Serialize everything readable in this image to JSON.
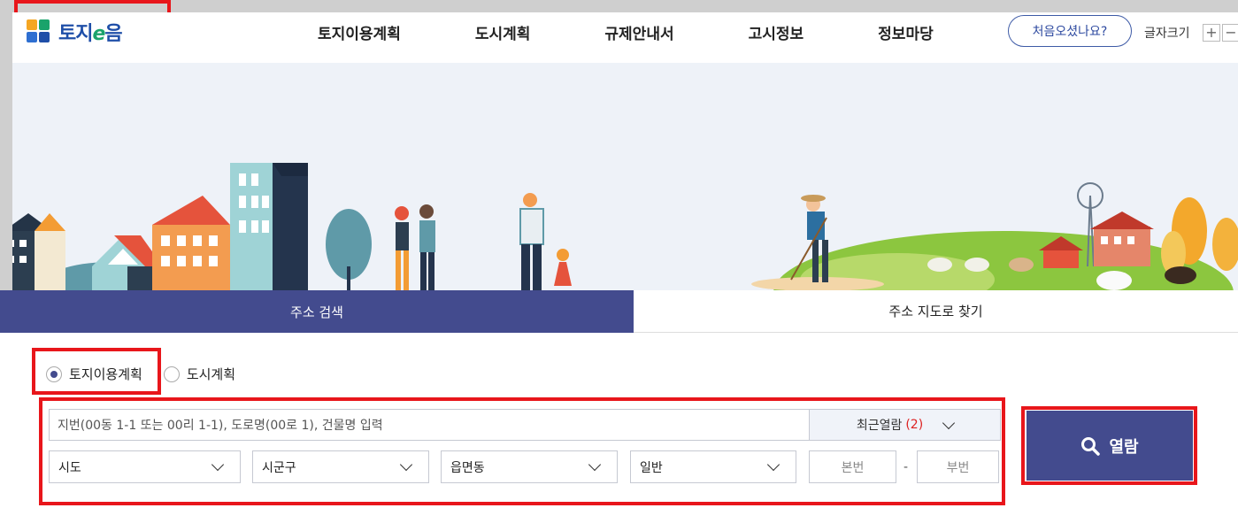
{
  "header": {
    "logo_text_a": "토지",
    "logo_text_e": "e",
    "logo_text_b": "음",
    "nav": [
      "토지이용계획",
      "도시계획",
      "규제안내서",
      "고시정보",
      "정보마당"
    ],
    "first_visit": "처음오셨나요?",
    "font_size_label": "글자크기",
    "font_plus": "+",
    "font_minus": "−"
  },
  "tabs": {
    "address_search": "주소 검색",
    "map_search": "주소 지도로 찾기"
  },
  "search": {
    "radio_land": "토지이용계획",
    "radio_city": "도시계획",
    "placeholder": "지번(00동 1-1 또는 00리 1-1), 도로명(00로 1), 건물명 입력",
    "recent_label": "최근열람",
    "recent_count": "(2)",
    "sido": "시도",
    "sigungu": "시군구",
    "eupmyeondong": "읍면동",
    "lot_type": "일반",
    "main_no": "본번",
    "dash": "-",
    "sub_no": "부번",
    "view_button": "열람"
  },
  "colors": {
    "accent": "#434b8e",
    "highlight": "#e8161b",
    "recent_count": "#dd2222"
  }
}
